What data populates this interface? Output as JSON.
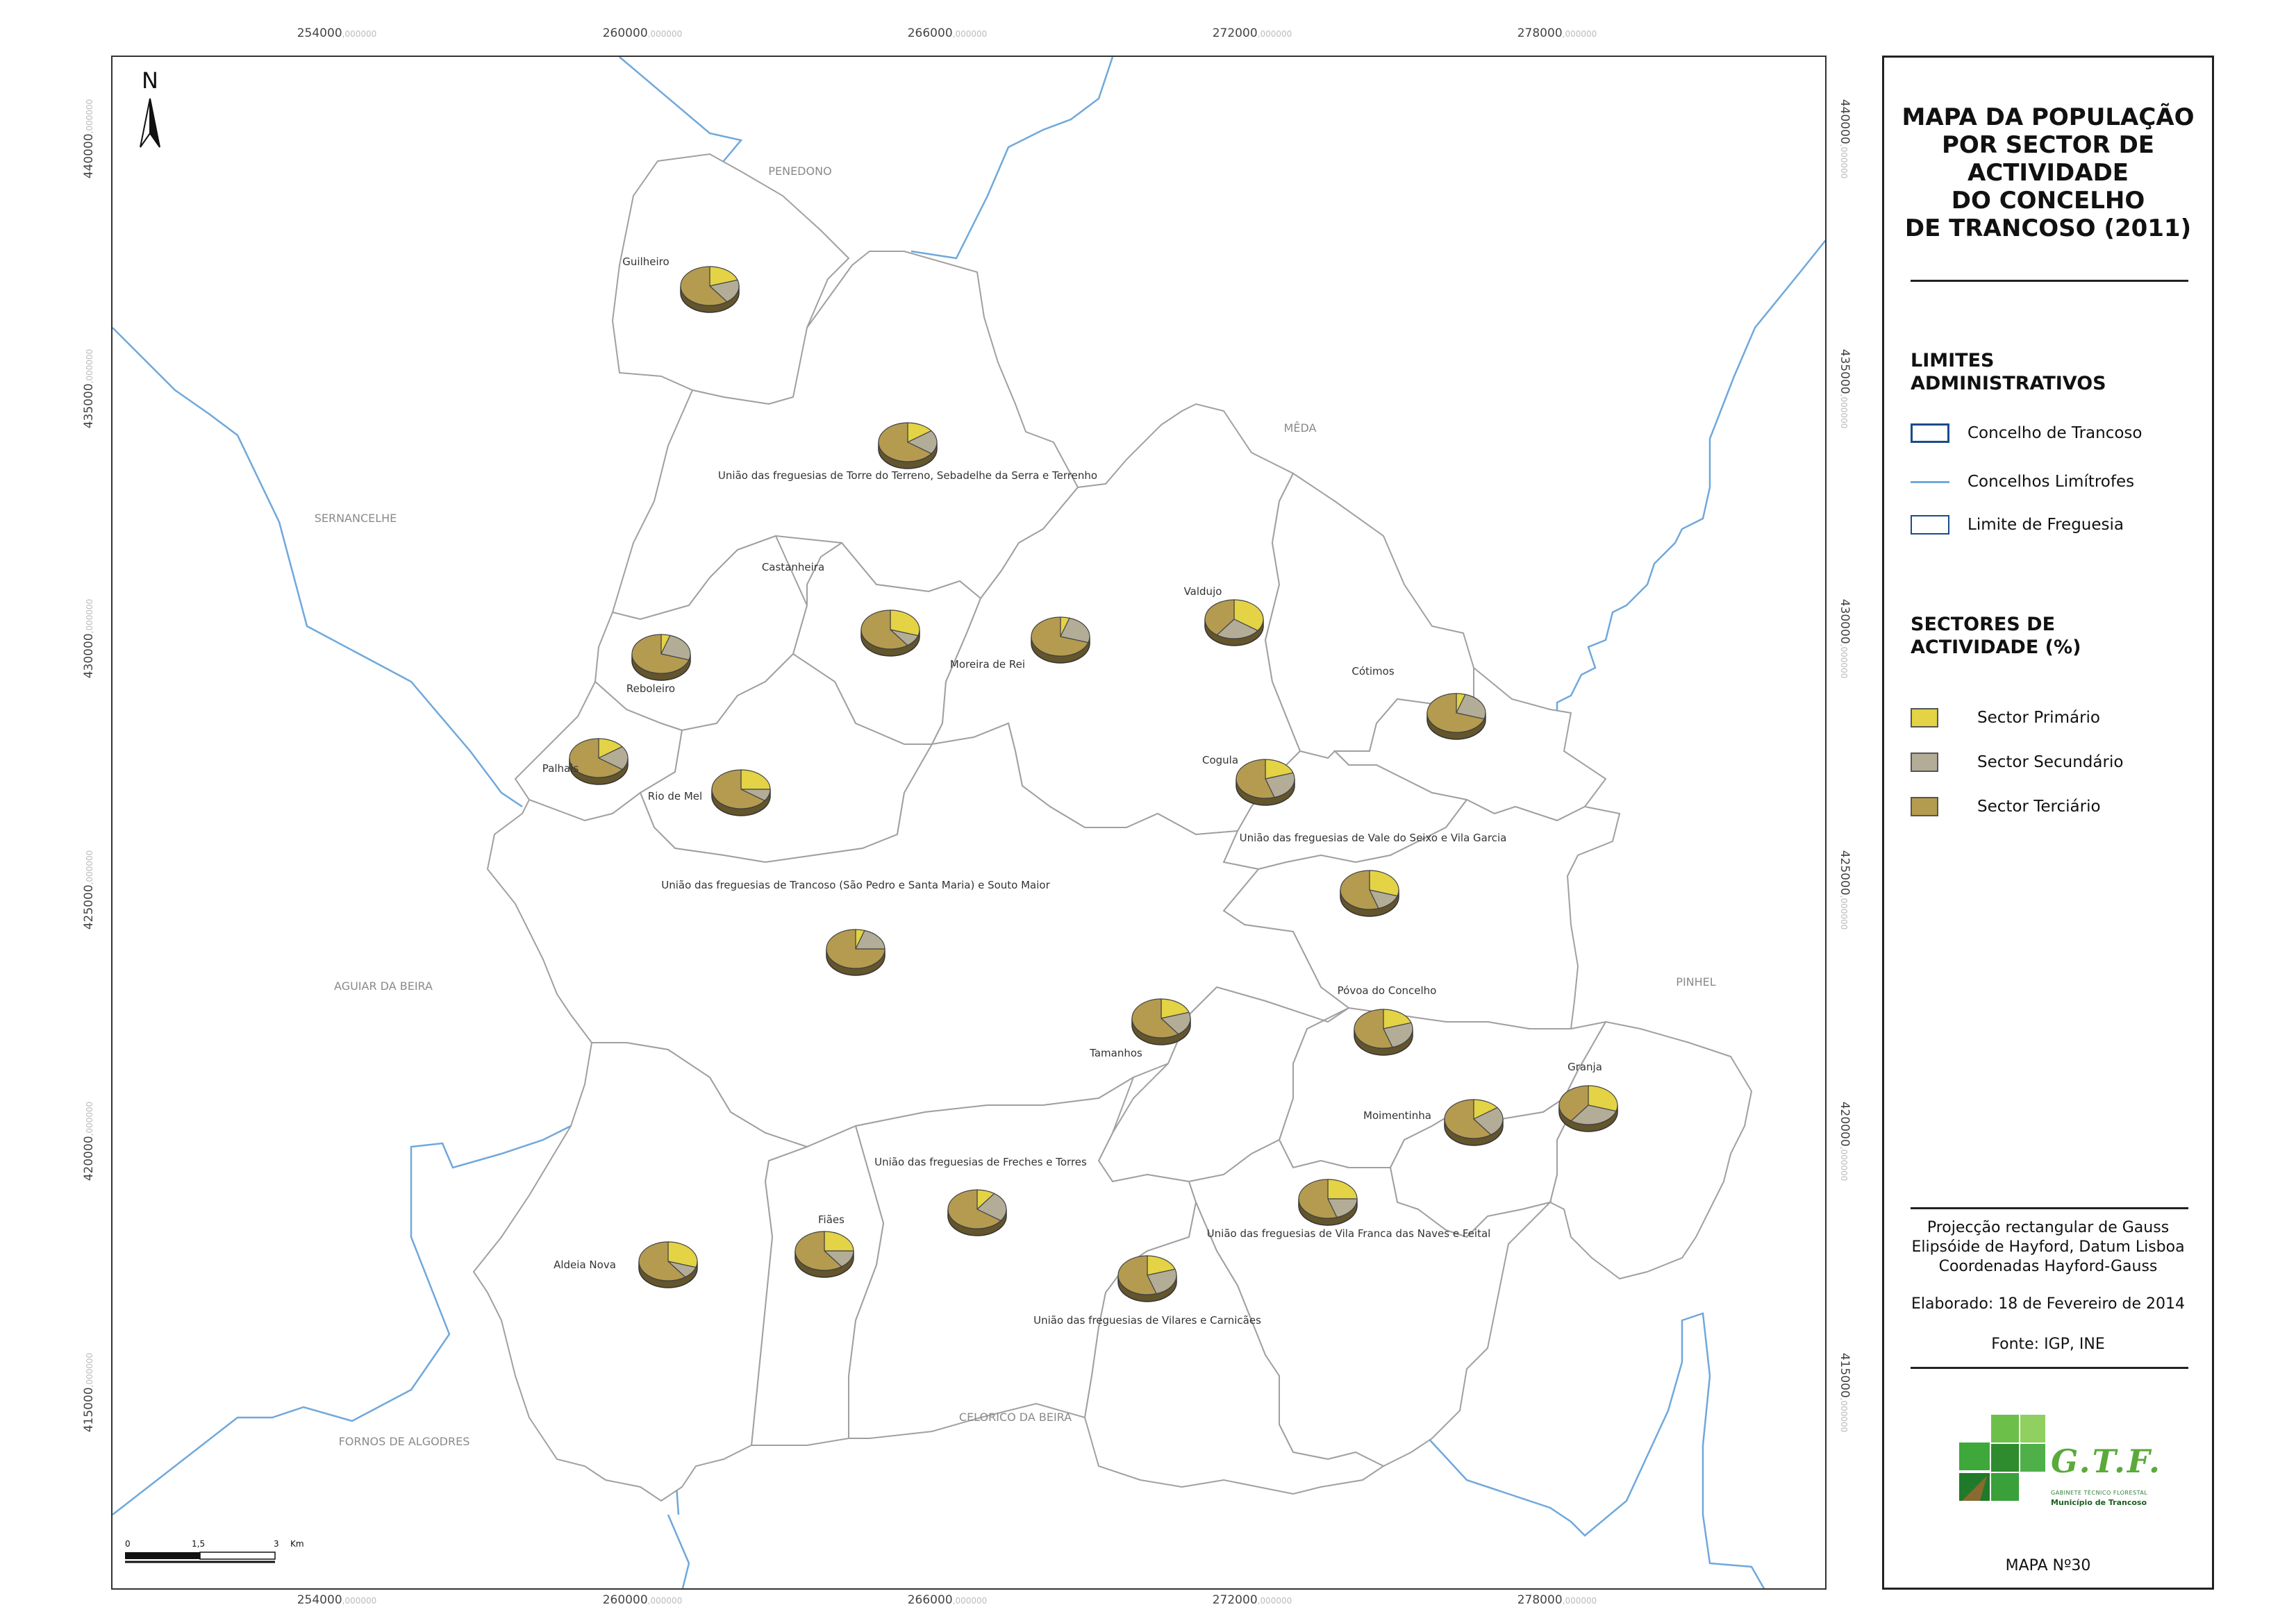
{
  "map": {
    "grid_top_labels": [
      {
        "main": "254000",
        "dec": ",000000"
      },
      {
        "main": "260000",
        "dec": ",000000"
      },
      {
        "main": "266000",
        "dec": ",000000"
      },
      {
        "main": "272000",
        "dec": ",000000"
      },
      {
        "main": "278000",
        "dec": ",000000"
      }
    ],
    "grid_side_labels": [
      {
        "main": "440000",
        "dec": ",000000"
      },
      {
        "main": "435000",
        "dec": ",000000"
      },
      {
        "main": "430000",
        "dec": ",000000"
      },
      {
        "main": "425000",
        "dec": ",000000"
      },
      {
        "main": "420000",
        "dec": ",000000"
      },
      {
        "main": "415000",
        "dec": ",000000"
      }
    ],
    "north_label": "N",
    "neighbors": [
      "PENEDONO",
      "SERNANCELHE",
      "MÊDA",
      "AGUIAR DA BEIRA",
      "PINHEL",
      "FORNOS DE ALGODRES",
      "CELORICO DA BEIRA"
    ],
    "parishes": [
      {
        "name": "Guilheiro",
        "shares": [
          20,
          20,
          60
        ]
      },
      {
        "name": "União das freguesias de Torre do Terreno, Sebadelhe da Serra e Terrenho",
        "shares": [
          15,
          20,
          65
        ]
      },
      {
        "name": "Castanheira",
        "shares": [
          30,
          10,
          60
        ]
      },
      {
        "name": "Moreira de Rei",
        "shares": [
          5,
          25,
          70
        ]
      },
      {
        "name": "Valdujo",
        "shares": [
          35,
          25,
          40
        ]
      },
      {
        "name": "Reboleiro",
        "shares": [
          5,
          25,
          70
        ]
      },
      {
        "name": "Cótimos",
        "shares": [
          5,
          25,
          70
        ]
      },
      {
        "name": "Palhais",
        "shares": [
          15,
          20,
          65
        ]
      },
      {
        "name": "Rio de Mel",
        "shares": [
          25,
          10,
          65
        ]
      },
      {
        "name": "Cogula",
        "shares": [
          20,
          25,
          55
        ]
      },
      {
        "name": "União das freguesias de Vale do Seixo e Vila Garcia",
        "shares": [
          30,
          15,
          55
        ]
      },
      {
        "name": "União das freguesias de Trancoso (São Pedro e Santa Maria) e Souto Maior",
        "shares": [
          5,
          20,
          75
        ]
      },
      {
        "name": "Póvoa do Concelho",
        "shares": [
          20,
          25,
          55
        ]
      },
      {
        "name": "Tamanhos",
        "shares": [
          20,
          20,
          60
        ]
      },
      {
        "name": "Granja",
        "shares": [
          30,
          30,
          40
        ]
      },
      {
        "name": "Moimentinha",
        "shares": [
          15,
          25,
          60
        ]
      },
      {
        "name": "União das freguesias de Freches e Torres",
        "shares": [
          10,
          25,
          65
        ]
      },
      {
        "name": "União das freguesias de Vila Franca das Naves e Feital",
        "shares": [
          25,
          20,
          55
        ]
      },
      {
        "name": "Fiães",
        "shares": [
          25,
          15,
          60
        ]
      },
      {
        "name": "Aldeia Nova",
        "shares": [
          30,
          10,
          60
        ]
      },
      {
        "name": "União das freguesias de Vilares e Carnicães",
        "shares": [
          20,
          25,
          55
        ]
      }
    ],
    "scale_bar": {
      "labels": [
        "0",
        "1,5",
        "3",
        "Km"
      ]
    }
  },
  "legend": {
    "title_lines": [
      "MAPA DA POPULAÇÃO",
      "POR SECTOR DE",
      "ACTIVIDADE",
      "DO CONCELHO",
      "DE TRANCOSO (2011)"
    ],
    "limits_title_lines": [
      "LIMITES",
      "ADMINISTRATIVOS"
    ],
    "limits": [
      {
        "label": "Concelho de Trancoso"
      },
      {
        "label": "Concelhos Limítrofes"
      },
      {
        "label": "Limite de Freguesia"
      }
    ],
    "sectors_title_lines": [
      "SECTORES DE",
      "ACTIVIDADE (%)"
    ],
    "sectors": [
      {
        "label": "Sector Primário",
        "color": "#e3d345"
      },
      {
        "label": "Sector Secundário",
        "color": "#b3ad98"
      },
      {
        "label": "Sector Terciário",
        "color": "#b49b50"
      }
    ],
    "projection_lines": [
      "Projecção rectangular de Gauss",
      "Elipsóide de Hayford, Datum Lisboa",
      "Coordenadas Hayford-Gauss"
    ],
    "elaborated": "Elaborado: 18 de Fevereiro de 2014",
    "source": "Fonte: IGP, INE",
    "logo_letters": "G.T.F.",
    "logo_sub1": "GABINETE TÉCNICO FLORESTAL",
    "logo_sub2": "Município de Trancoso",
    "map_number": "MAPA Nº30"
  },
  "colors": {
    "parish_border": "#a0a0a0",
    "river_line": "#6fa8dc",
    "label_text": "#333333",
    "neighbor_text": "#8a8a8a"
  }
}
